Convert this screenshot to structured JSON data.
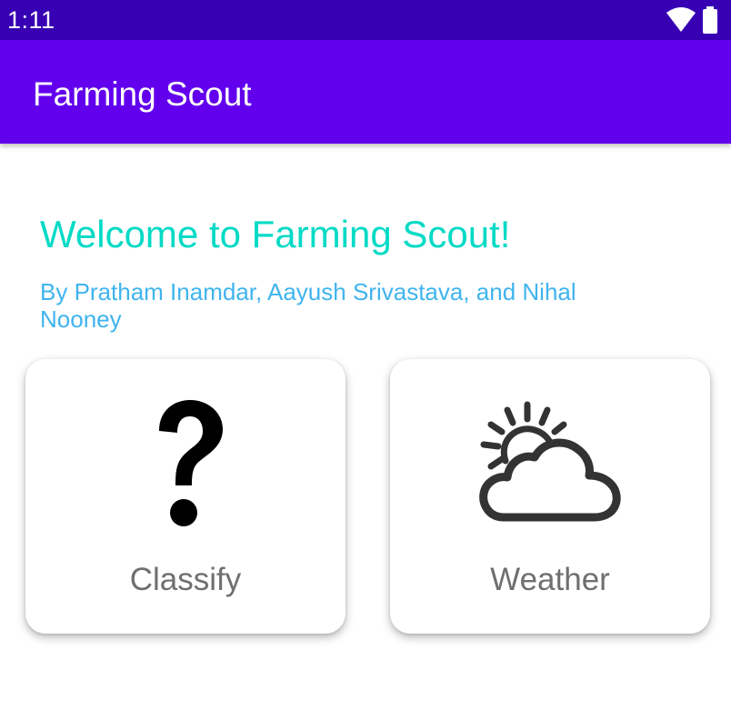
{
  "status_bar": {
    "time": "1:11",
    "icons": [
      "wifi-icon",
      "battery-icon"
    ]
  },
  "app_bar": {
    "title": "Farming Scout"
  },
  "main": {
    "welcome": "Welcome to Farming Scout!",
    "authors": "By Pratham Inamdar, Aayush Srivastava, and Nihal Nooney",
    "cards": [
      {
        "label": "Classify",
        "icon": "question-mark-icon"
      },
      {
        "label": "Weather",
        "icon": "partly-cloudy-icon"
      }
    ]
  },
  "colors": {
    "status_bar": "#3700B3",
    "app_bar": "#6200EE",
    "welcome_text": "#03DAC5",
    "authors_text": "#40B4EE",
    "card_label": "#6F6F6F"
  }
}
